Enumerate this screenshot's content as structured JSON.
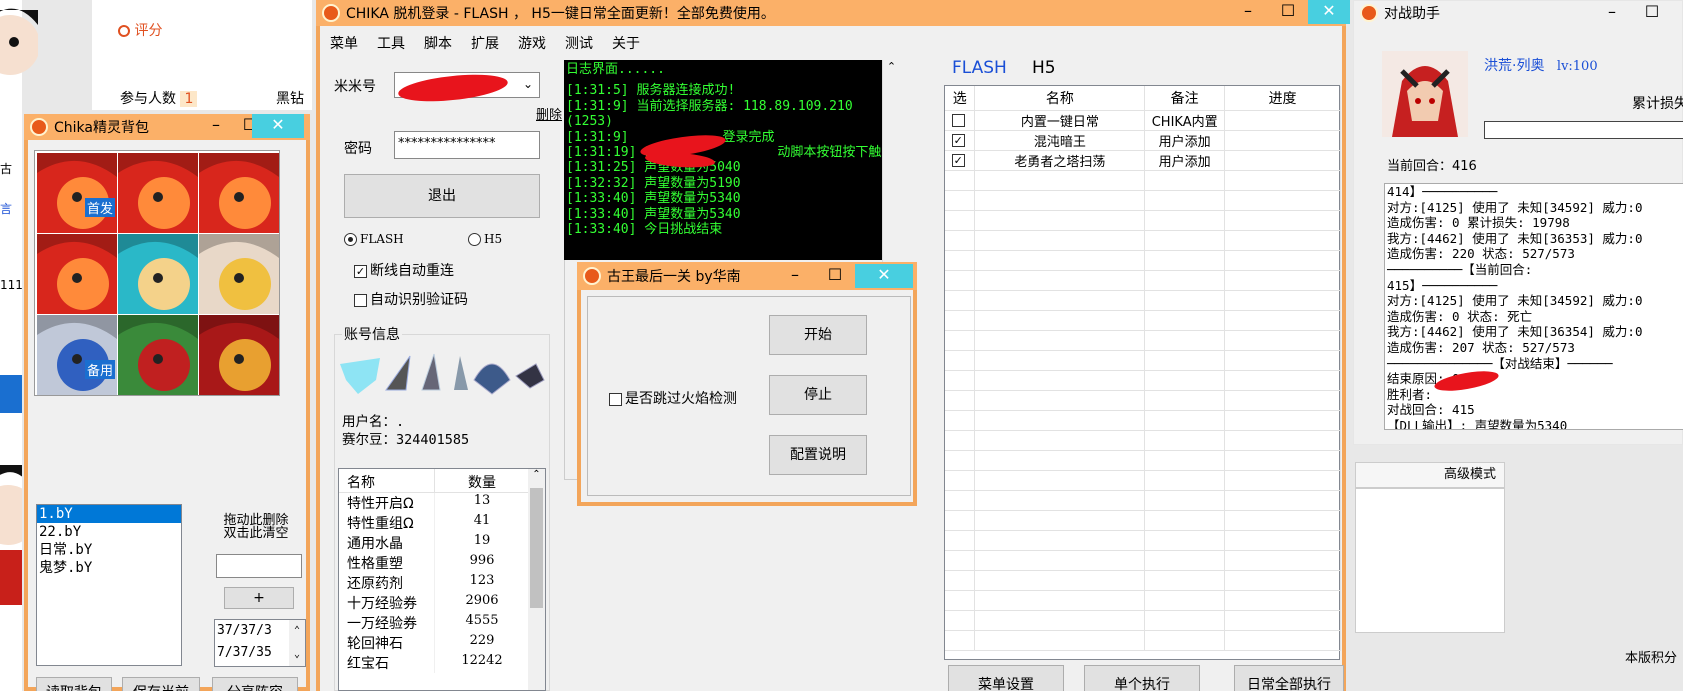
{
  "bg": {
    "rating": "评分",
    "participants_label": "参与人数",
    "participants_count": "1",
    "black": "黑钻",
    "frag1": "古",
    "frag2": "言",
    "frag3": "111",
    "advanced_mode": "高级模式",
    "version_score": "本版积分"
  },
  "main": {
    "title": "CHIKA 脱机登录 - FLASH ， H5一键日常全面更新！全部免费使用。",
    "menu": [
      "菜单",
      "工具",
      "脚本",
      "扩展",
      "游戏",
      "测试",
      "关于"
    ],
    "account_label": "米米号",
    "delete_label": "删除",
    "password_label": "密码",
    "password_value": "***************",
    "logout": "退出",
    "radio_flash": "FLASH",
    "radio_h5": "H5",
    "auto_reconnect": "断线自动重连",
    "auto_captcha": "自动识别验证码",
    "account_info": "账号信息",
    "username": "用户名：.",
    "saier": "赛尔豆：324401585",
    "inv_headers": [
      "名称",
      "数量"
    ],
    "inventory": [
      [
        "特性开启Ω",
        "13"
      ],
      [
        "特性重组Ω",
        "41"
      ],
      [
        "通用水晶",
        "19"
      ],
      [
        "性格重塑",
        "996"
      ],
      [
        "还原药剂",
        "123"
      ],
      [
        "十万经验券",
        "2906"
      ],
      [
        "一万经验券",
        "4555"
      ],
      [
        "轮回神石",
        "229"
      ],
      [
        "红宝石",
        "12242"
      ]
    ],
    "log_title": "日志界面......",
    "log_lines": [
      "[1:31:5] 服务器连接成功!",
      "[1:31:9] 当前选择服务器: 118.89.109.210",
      "(1253)",
      "[1:31:9]            登录完成",
      "[1:31:19] 1                动脚本按钮按下触发",
      "[1:31:25] 声望数量为5040",
      "[1:32:32] 声望数量为5190",
      "[1:33:40] 声望数量为5340",
      "[1:33:40] 声望数量为5340",
      "[1:33:40] 今日挑战结束"
    ],
    "tab_flash": "FLASH",
    "tab_h5": "H5",
    "task_headers": [
      "选",
      "名称",
      "备注",
      "进度"
    ],
    "tasks": [
      {
        "checked": false,
        "name": "内置一键日常",
        "note": "CHIKA内置"
      },
      {
        "checked": true,
        "name": "混沌暗王",
        "note": "用户添加"
      },
      {
        "checked": true,
        "name": "老勇者之塔扫荡",
        "note": "用户添加"
      }
    ],
    "btn_menu_settings": "菜单设置",
    "btn_single": "单个执行",
    "btn_all": "日常全部执行"
  },
  "bag": {
    "title": "Chika精灵背包",
    "tag_first": "首发",
    "tag_backup": "备用",
    "list": [
      "1.bY",
      "22.bY",
      "日常.bY",
      "鬼梦.bY"
    ],
    "drag_hint": "拖动此删除\n双击此清空",
    "plus": "+",
    "counter1": "37/37/3",
    "counter2": "7/37/35",
    "read": "读取背包",
    "save": "保存当前",
    "share": "分享阵容"
  },
  "dialog": {
    "title": "古王最后一关 by华南",
    "skip_fire": "是否跳过火焰检测",
    "start": "开始",
    "stop": "停止",
    "config": "配置说明"
  },
  "battle": {
    "title": "对战助手",
    "name": "洪荒·列奥",
    "level": "lv:100",
    "total_loss": "累计损失",
    "current_round": "当前回合：416",
    "lines": [
      "414】──────────",
      "对方:[4125] 使用了 未知[34592] 威力:0",
      "造成伤害: 0 累计损失: 19798",
      "我方:[4462] 使用了 未知[36353] 威力:0",
      "造成伤害: 220 状态: 527/573",
      "──────────【当前回合:",
      "415】──────────",
      "对方:[4125] 使用了 未知[34592] 威力:0",
      "造成伤害: 0 状态: 死亡",
      "我方:[4462] 使用了 未知[36354] 威力:0",
      "造成伤害: 207 状态: 527/573",
      "──────────────【对战结束】──────",
      "结束原因: 0",
      "胜利者:         ",
      "对战回合: 415",
      "【DLL输出】: 声望数量为5340"
    ]
  },
  "colors": {
    "accent": "#fbb068",
    "close": "#48cfe0",
    "log_bg": "#000000",
    "log_text": "#33ff33",
    "link": "#1a4fd6",
    "select": "#0078d7"
  }
}
